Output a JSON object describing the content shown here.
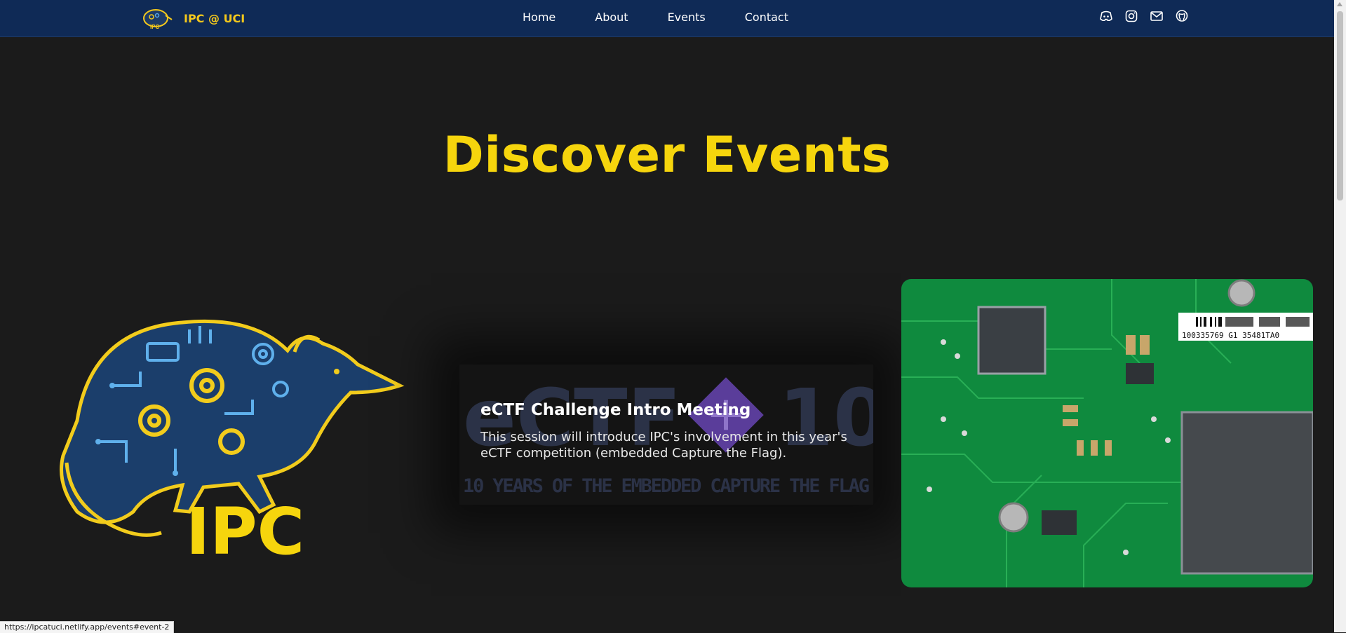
{
  "brand": {
    "name": "IPC @ UCI",
    "logo_icon": "anteater-logo-icon"
  },
  "nav": {
    "links": [
      "Home",
      "About",
      "Events",
      "Contact"
    ],
    "icons": [
      "discord-icon",
      "instagram-icon",
      "mail-icon",
      "github-icon"
    ]
  },
  "page": {
    "title": "Discover Events"
  },
  "events": {
    "left_card": {
      "logo_text": "IPC"
    },
    "center_card": {
      "bg_big_text_a": "eCTF",
      "bg_big_text_b": "10",
      "bg_tagline": "10 YEARS OF THE EMBEDDED CAPTURE THE FLAG",
      "title": "eCTF Challenge Intro Meeting",
      "description": "This session will introduce IPC's involvement in this year's eCTF competition (embedded Capture the Flag)."
    },
    "right_card": {
      "chip_label": "100335769   G1   35481TA0"
    }
  },
  "status_bar": {
    "url": "https://ipcatuci.netlify.app/events#event-2"
  },
  "colors": {
    "accent": "#f6d50d",
    "navbar": "#0f2a56",
    "background": "#1b1b1b",
    "pcb_green": "#0f8a3e"
  }
}
